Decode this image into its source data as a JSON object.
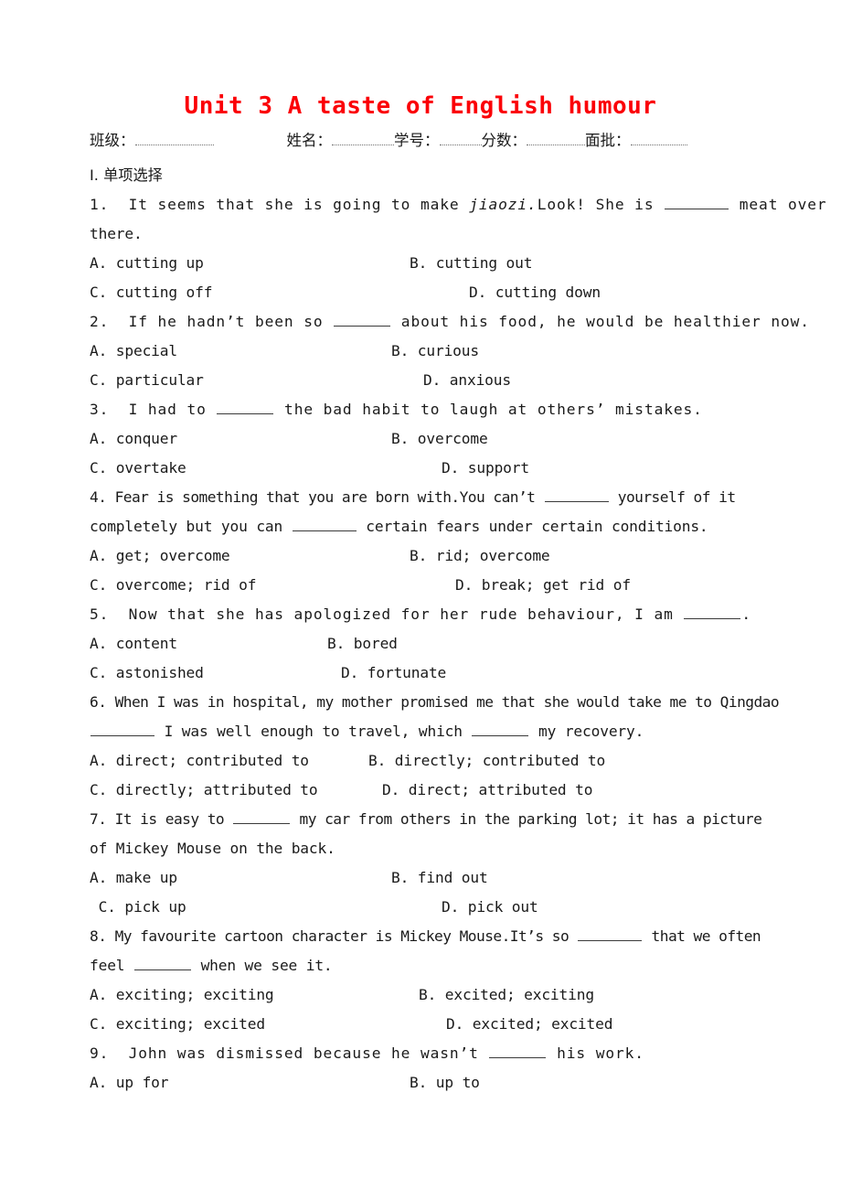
{
  "document": {
    "title": "Unit 3 A taste of English humour",
    "title_color": "#fb0007",
    "header_fields": [
      {
        "label": "班级：",
        "name": "class-field"
      },
      {
        "label": "姓名：",
        "name": "name-field"
      },
      {
        "label": "学号：",
        "name": "student-number-field"
      },
      {
        "label": "分数：",
        "name": "score-field"
      },
      {
        "label": "面批：",
        "name": "face-review-field"
      }
    ],
    "section_heading": "Ⅰ. 单项选择",
    "questions": [
      {
        "number": "1.",
        "stem_lines": [
          "1.  It seems that she is going to make ",
          "jiaozi.",
          "Look! She is ",
          " meat over",
          "there."
        ],
        "stem_plain": "1.  It seems that she is going to make jiaozi.Look! She is ______ meat over there.",
        "options": {
          "A": "A. cutting up",
          "B": "B. cutting out",
          "C": "C. cutting off",
          "D": "D. cutting down"
        }
      },
      {
        "number": "2.",
        "stem_plain": "2.  If he hadn’t been so ______ about his food, he would be healthier now.",
        "stem_pre": "2.  If he hadn’t been so ",
        "stem_post": " about his food, he would be healthier now.",
        "options": {
          "A": "A. special",
          "B": "B. curious",
          "C": "C. particular",
          "D": "D. anxious"
        }
      },
      {
        "number": "3.",
        "stem_plain": "3.  I had to ______ the bad habit to laugh at others’ mistakes.",
        "stem_pre": "3.  I had to ",
        "stem_post": " the bad habit to laugh at others’ mistakes.",
        "options": {
          "A": "A. conquer",
          "B": "B. overcome",
          "C": "C. overtake",
          "D": "D. support"
        }
      },
      {
        "number": "4.",
        "stem_plain": "4. Fear is something that you are born with.You can’t ______ yourself of it completely but you can ______ certain fears under certain conditions.",
        "stem_l1_pre": "4. Fear is something that you are born with.You can’t ",
        "stem_l1_post": " yourself of it",
        "stem_l2_pre": "completely but you can ",
        "stem_l2_post": " certain fears under certain conditions.",
        "options": {
          "A": "A. get; overcome",
          "B": "B. rid; overcome",
          "C": "C. overcome; rid of",
          "D": "D. break; get rid of"
        }
      },
      {
        "number": "5.",
        "stem_plain": "5.  Now that she has apologized for her rude behaviour, I am ______.",
        "stem_pre": "5.  Now that she has apologized for her rude behaviour, I am ",
        "stem_post": ".",
        "options": {
          "A": "A. content",
          "B": "B. bored",
          "C": "C. astonished",
          "D": "D. fortunate"
        }
      },
      {
        "number": "6.",
        "stem_plain": "6. When I was in hospital, my mother promised me that she would take me to Qingdao ______ I was well enough to travel, which ______ my recovery.",
        "stem_l1": "6. When I was in hospital, my mother promised me that she would take me to Qingdao",
        "stem_l2_mid": " I was well enough to travel, which ",
        "stem_l2_post": " my recovery.",
        "options": {
          "A": "A. direct; contributed to",
          "B": "B. directly; contributed to",
          "C": "C. directly; attributed to",
          "D": "D. direct; attributed to"
        }
      },
      {
        "number": "7.",
        "stem_plain": "7. It is easy to ______ my car from others in the parking lot; it has a picture of Mickey Mouse on the back.",
        "stem_l1_pre": "7. It is easy to ",
        "stem_l1_post": " my car from others in the parking lot; it has a picture",
        "stem_l2": "of Mickey Mouse on the back.",
        "options": {
          "A": "A. make up",
          "B": "B. find out",
          "C": " C. pick up",
          "D": "D. pick out"
        }
      },
      {
        "number": "8.",
        "stem_plain": "8. My favourite cartoon character is Mickey Mouse.It’s so ______ that we often feel ______ when we see it.",
        "stem_l1_pre": "8. My favourite cartoon character is Mickey Mouse.It’s so ",
        "stem_l1_post": " that we often",
        "stem_l2_pre": "feel ",
        "stem_l2_post": " when we see it.",
        "options": {
          "A": "A. exciting; exciting",
          "B": "B. excited; exciting",
          "C": "C. exciting; excited",
          "D": "D. excited; excited"
        }
      },
      {
        "number": "9.",
        "stem_plain": "9.  John was dismissed because he wasn’t ______ his work.",
        "stem_pre": "9.  John was dismissed because he wasn’t ",
        "stem_post": " his work.",
        "options": {
          "A": "A. up for",
          "B": "B. up to"
        }
      }
    ]
  }
}
